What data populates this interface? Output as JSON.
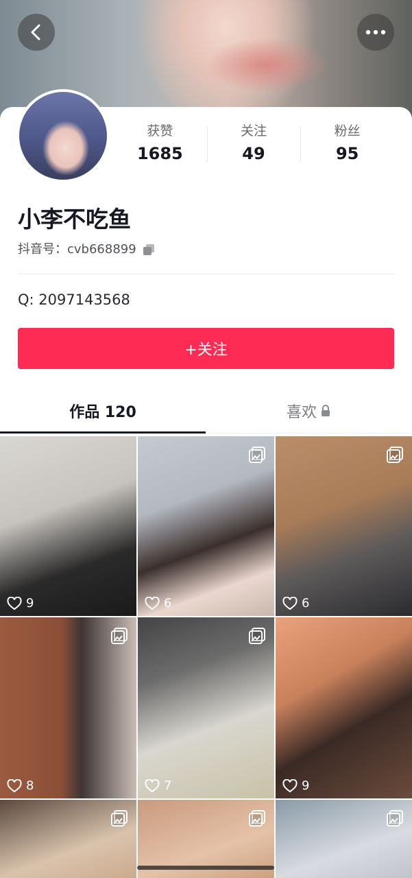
{
  "header": {
    "back_icon": "chevron-left-icon",
    "more_icon": "more-horizontal-icon"
  },
  "profile": {
    "stats": [
      {
        "label": "获赞",
        "value": "1685"
      },
      {
        "label": "关注",
        "value": "49"
      },
      {
        "label": "粉丝",
        "value": "95"
      }
    ],
    "nickname": "小李不吃鱼",
    "douyin_id_label": "抖音号：cvb668899",
    "qq_text": "Q:  2097143568",
    "follow_label": "+关注"
  },
  "tabs": {
    "works": "作品 120",
    "likes": "喜欢"
  },
  "posts": [
    {
      "likes": "9",
      "bg": "linear-gradient(160deg,#d9d7d2 0%,#c7c4bf 40%,#2b2a2a 70%,#1a1a1a 100%)",
      "gallery": false
    },
    {
      "likes": "6",
      "bg": "linear-gradient(160deg,#c5c9d0 0%,#b4b8c0 35%,#3a2f2c 60%,#ead7cf 80%,#c9b7ad 100%)",
      "gallery": true
    },
    {
      "likes": "6",
      "bg": "linear-gradient(160deg,#b98e69 0%,#a97c58 40%,#5d5a5a 65%,#2b2b2e 100%)",
      "gallery": true
    },
    {
      "likes": "8",
      "bg": "linear-gradient(90deg,#9b5b40 0%,#8b4f38 45%,#3e3535 60%,#c9bdb5 100%)",
      "gallery": true
    },
    {
      "likes": "7",
      "bg": "linear-gradient(160deg,#444 0%,#6c6c6c 30%,#d8d6cf 60%,#c9c2a8 100%)",
      "gallery": true
    },
    {
      "likes": "9",
      "bg": "linear-gradient(150deg,#e9a27c 0%,#c9815c 35%,#3a2a25 60%,#6b4b3c 100%)",
      "gallery": false
    },
    {
      "likes": "",
      "bg": "linear-gradient(160deg,#5a4a3f 0%,#d9c3ad 60%,#caa98c 100%)",
      "gallery": true
    },
    {
      "likes": "",
      "bg": "linear-gradient(160deg,#c99a7e 0%,#e4c2a8 60%,#caa07f 100%)",
      "gallery": true
    },
    {
      "likes": "",
      "bg": "linear-gradient(160deg,#8a9aa6 0%,#d8dbe0 60%,#bfc3c8 100%)",
      "gallery": true
    }
  ]
}
